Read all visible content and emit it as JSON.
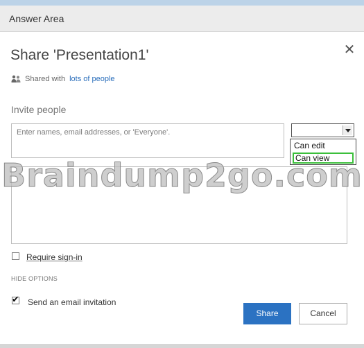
{
  "answer_area": {
    "title": "Answer Area"
  },
  "dialog": {
    "title": "Share 'Presentation1'",
    "close_icon": "close-icon"
  },
  "shared": {
    "prefix": "Shared with",
    "link_text": "lots of people",
    "icon": "people-icon"
  },
  "invite": {
    "label": "Invite people",
    "input_placeholder": "Enter names, email addresses, or 'Everyone'.",
    "permission_selected": "",
    "permission_options": [
      "Can edit",
      "Can view"
    ],
    "highlighted_option_color": "#3bbf3b"
  },
  "message": {
    "placeholder": ""
  },
  "watermark": "Braindump2go.com",
  "require_signin": {
    "label": "Require sign-in",
    "checked": false
  },
  "hide_options": {
    "label": "HIDE OPTIONS"
  },
  "email_invitation": {
    "label": "Send an email invitation",
    "checked": true
  },
  "buttons": {
    "share": "Share",
    "cancel": "Cancel",
    "share_color": "#2b72c2"
  }
}
